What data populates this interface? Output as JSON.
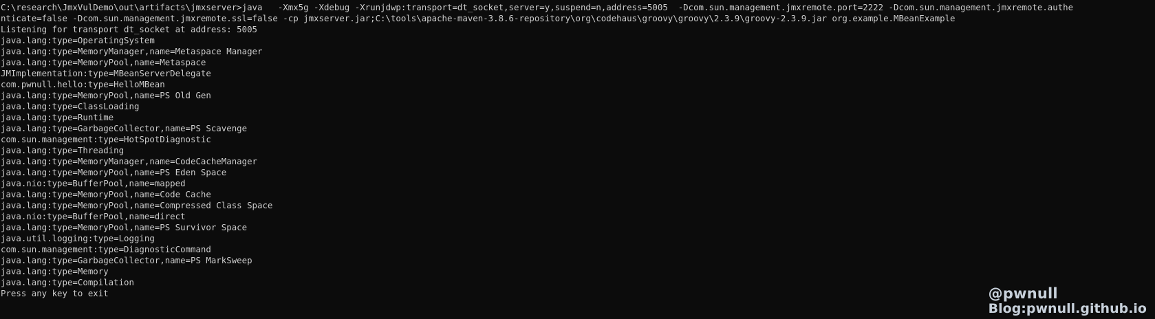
{
  "terminal": {
    "lines": [
      "C:\\research\\JmxVulDemo\\out\\artifacts\\jmxserver>java   -Xmx5g -Xdebug -Xrunjdwp:transport=dt_socket,server=y,suspend=n,address=5005  -Dcom.sun.management.jmxremote.port=2222 -Dcom.sun.management.jmxremote.authe",
      "nticate=false -Dcom.sun.management.jmxremote.ssl=false -cp jmxserver.jar;C:\\tools\\apache-maven-3.8.6-repository\\org\\codehaus\\groovy\\groovy\\2.3.9\\groovy-2.3.9.jar org.example.MBeanExample",
      "Listening for transport dt_socket at address: 5005",
      "java.lang:type=OperatingSystem",
      "java.lang:type=MemoryManager,name=Metaspace Manager",
      "java.lang:type=MemoryPool,name=Metaspace",
      "JMImplementation:type=MBeanServerDelegate",
      "com.pwnull.hello:type=HelloMBean",
      "java.lang:type=MemoryPool,name=PS Old Gen",
      "java.lang:type=ClassLoading",
      "java.lang:type=Runtime",
      "java.lang:type=GarbageCollector,name=PS Scavenge",
      "com.sun.management:type=HotSpotDiagnostic",
      "java.lang:type=Threading",
      "java.lang:type=MemoryManager,name=CodeCacheManager",
      "java.lang:type=MemoryPool,name=PS Eden Space",
      "java.nio:type=BufferPool,name=mapped",
      "java.lang:type=MemoryPool,name=Code Cache",
      "java.lang:type=MemoryPool,name=Compressed Class Space",
      "java.nio:type=BufferPool,name=direct",
      "java.lang:type=MemoryPool,name=PS Survivor Space",
      "java.util.logging:type=Logging",
      "com.sun.management:type=DiagnosticCommand",
      "java.lang:type=GarbageCollector,name=PS MarkSweep",
      "java.lang:type=Memory",
      "java.lang:type=Compilation",
      "Press any key to exit"
    ]
  },
  "watermark": {
    "handle": "@pwnull",
    "blog": "Blog:pwnull.github.io"
  }
}
